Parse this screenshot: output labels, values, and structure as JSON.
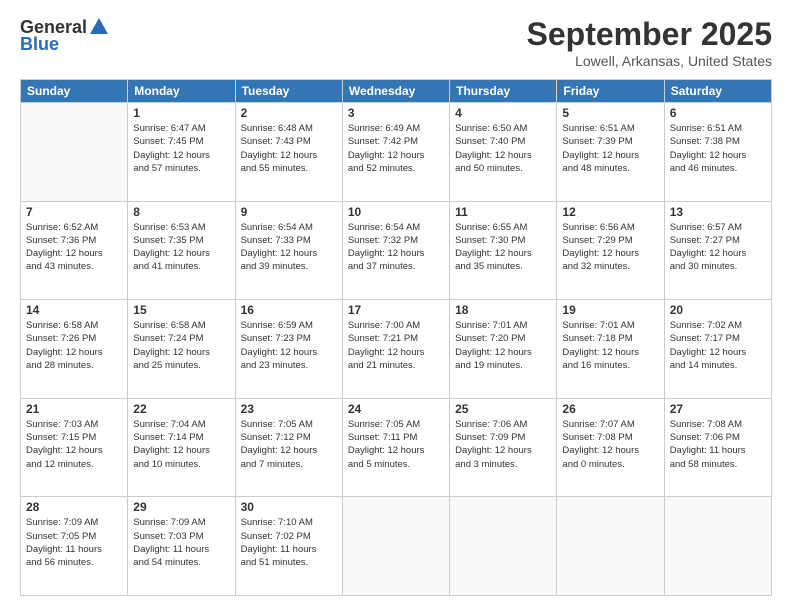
{
  "header": {
    "logo_general": "General",
    "logo_blue": "Blue",
    "month": "September 2025",
    "location": "Lowell, Arkansas, United States"
  },
  "days_of_week": [
    "Sunday",
    "Monday",
    "Tuesday",
    "Wednesday",
    "Thursday",
    "Friday",
    "Saturday"
  ],
  "weeks": [
    [
      {
        "day": "",
        "info": ""
      },
      {
        "day": "1",
        "info": "Sunrise: 6:47 AM\nSunset: 7:45 PM\nDaylight: 12 hours\nand 57 minutes."
      },
      {
        "day": "2",
        "info": "Sunrise: 6:48 AM\nSunset: 7:43 PM\nDaylight: 12 hours\nand 55 minutes."
      },
      {
        "day": "3",
        "info": "Sunrise: 6:49 AM\nSunset: 7:42 PM\nDaylight: 12 hours\nand 52 minutes."
      },
      {
        "day": "4",
        "info": "Sunrise: 6:50 AM\nSunset: 7:40 PM\nDaylight: 12 hours\nand 50 minutes."
      },
      {
        "day": "5",
        "info": "Sunrise: 6:51 AM\nSunset: 7:39 PM\nDaylight: 12 hours\nand 48 minutes."
      },
      {
        "day": "6",
        "info": "Sunrise: 6:51 AM\nSunset: 7:38 PM\nDaylight: 12 hours\nand 46 minutes."
      }
    ],
    [
      {
        "day": "7",
        "info": "Sunrise: 6:52 AM\nSunset: 7:36 PM\nDaylight: 12 hours\nand 43 minutes."
      },
      {
        "day": "8",
        "info": "Sunrise: 6:53 AM\nSunset: 7:35 PM\nDaylight: 12 hours\nand 41 minutes."
      },
      {
        "day": "9",
        "info": "Sunrise: 6:54 AM\nSunset: 7:33 PM\nDaylight: 12 hours\nand 39 minutes."
      },
      {
        "day": "10",
        "info": "Sunrise: 6:54 AM\nSunset: 7:32 PM\nDaylight: 12 hours\nand 37 minutes."
      },
      {
        "day": "11",
        "info": "Sunrise: 6:55 AM\nSunset: 7:30 PM\nDaylight: 12 hours\nand 35 minutes."
      },
      {
        "day": "12",
        "info": "Sunrise: 6:56 AM\nSunset: 7:29 PM\nDaylight: 12 hours\nand 32 minutes."
      },
      {
        "day": "13",
        "info": "Sunrise: 6:57 AM\nSunset: 7:27 PM\nDaylight: 12 hours\nand 30 minutes."
      }
    ],
    [
      {
        "day": "14",
        "info": "Sunrise: 6:58 AM\nSunset: 7:26 PM\nDaylight: 12 hours\nand 28 minutes."
      },
      {
        "day": "15",
        "info": "Sunrise: 6:58 AM\nSunset: 7:24 PM\nDaylight: 12 hours\nand 25 minutes."
      },
      {
        "day": "16",
        "info": "Sunrise: 6:59 AM\nSunset: 7:23 PM\nDaylight: 12 hours\nand 23 minutes."
      },
      {
        "day": "17",
        "info": "Sunrise: 7:00 AM\nSunset: 7:21 PM\nDaylight: 12 hours\nand 21 minutes."
      },
      {
        "day": "18",
        "info": "Sunrise: 7:01 AM\nSunset: 7:20 PM\nDaylight: 12 hours\nand 19 minutes."
      },
      {
        "day": "19",
        "info": "Sunrise: 7:01 AM\nSunset: 7:18 PM\nDaylight: 12 hours\nand 16 minutes."
      },
      {
        "day": "20",
        "info": "Sunrise: 7:02 AM\nSunset: 7:17 PM\nDaylight: 12 hours\nand 14 minutes."
      }
    ],
    [
      {
        "day": "21",
        "info": "Sunrise: 7:03 AM\nSunset: 7:15 PM\nDaylight: 12 hours\nand 12 minutes."
      },
      {
        "day": "22",
        "info": "Sunrise: 7:04 AM\nSunset: 7:14 PM\nDaylight: 12 hours\nand 10 minutes."
      },
      {
        "day": "23",
        "info": "Sunrise: 7:05 AM\nSunset: 7:12 PM\nDaylight: 12 hours\nand 7 minutes."
      },
      {
        "day": "24",
        "info": "Sunrise: 7:05 AM\nSunset: 7:11 PM\nDaylight: 12 hours\nand 5 minutes."
      },
      {
        "day": "25",
        "info": "Sunrise: 7:06 AM\nSunset: 7:09 PM\nDaylight: 12 hours\nand 3 minutes."
      },
      {
        "day": "26",
        "info": "Sunrise: 7:07 AM\nSunset: 7:08 PM\nDaylight: 12 hours\nand 0 minutes."
      },
      {
        "day": "27",
        "info": "Sunrise: 7:08 AM\nSunset: 7:06 PM\nDaylight: 11 hours\nand 58 minutes."
      }
    ],
    [
      {
        "day": "28",
        "info": "Sunrise: 7:09 AM\nSunset: 7:05 PM\nDaylight: 11 hours\nand 56 minutes."
      },
      {
        "day": "29",
        "info": "Sunrise: 7:09 AM\nSunset: 7:03 PM\nDaylight: 11 hours\nand 54 minutes."
      },
      {
        "day": "30",
        "info": "Sunrise: 7:10 AM\nSunset: 7:02 PM\nDaylight: 11 hours\nand 51 minutes."
      },
      {
        "day": "",
        "info": ""
      },
      {
        "day": "",
        "info": ""
      },
      {
        "day": "",
        "info": ""
      },
      {
        "day": "",
        "info": ""
      }
    ]
  ]
}
